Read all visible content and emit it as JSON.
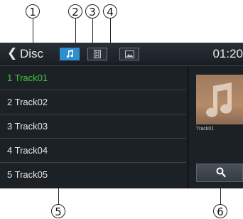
{
  "header": {
    "back_glyph": "❮",
    "title": "Disc",
    "tabs": [
      {
        "icon": "music-note-icon",
        "active": true
      },
      {
        "icon": "film-icon",
        "active": false
      },
      {
        "icon": "image-icon",
        "active": false
      }
    ],
    "clock": "01:20"
  },
  "track_list": {
    "items": [
      {
        "label": "1  Track01",
        "current": true
      },
      {
        "label": "2  Track02",
        "current": false
      },
      {
        "label": "3  Track03",
        "current": false
      },
      {
        "label": "4  Track04",
        "current": false
      },
      {
        "label": "5  Track05",
        "current": false
      }
    ]
  },
  "now_playing": {
    "album_art_icon": "music-note-icon",
    "caption": "Track01"
  },
  "search_button": {
    "icon": "search-icon"
  },
  "callouts": [
    "1",
    "2",
    "3",
    "4",
    "5",
    "6"
  ],
  "colors": {
    "accent": "#2d8fcf",
    "current_track": "#3fc53f",
    "background": "#1c2126"
  }
}
